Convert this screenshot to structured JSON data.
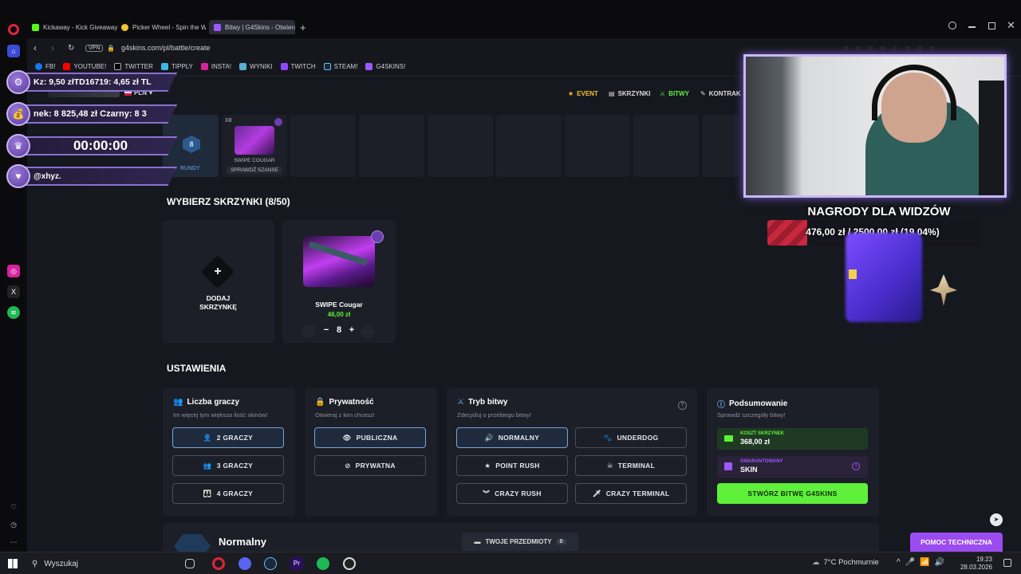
{
  "browser": {
    "tabs": [
      {
        "label": "Kickaway - Kick Giveaway",
        "color": "#53fc18"
      },
      {
        "label": "Picker Wheel - Spin the W",
        "color": "#f2c230"
      },
      {
        "label": "Bitwy | G4Skins - Otwieraj",
        "color": "#9b59ff",
        "active": true
      }
    ],
    "vpn": "VPN",
    "url": "g4skins.com/pl/battle/create",
    "bookmarks": [
      "FB!",
      "YOUTUBE!",
      "TWITTER",
      "TIPPLY",
      "INSTA!",
      "WYNIKI",
      "TWITCH",
      "STEAM!",
      "G4SKINS!"
    ]
  },
  "site": {
    "currency": "PLN",
    "nav": [
      "EVENT",
      "SKRZYNKI",
      "BITWY",
      "KONTRAK"
    ],
    "rounds": {
      "count": "8",
      "label": "RUNDY"
    },
    "top_case": {
      "multiplier": "X8",
      "name": "SWIPE COUGAR",
      "check_odds": "SPRAWDŹ SZANSE"
    },
    "select_title": "WYBIERZ SKRZYNKI (8/50)",
    "add_case": {
      "line1": "DODAJ",
      "line2": "SKRZYNKĘ"
    },
    "case_card": {
      "name": "SWIPE Cougar",
      "price": "46,00 zł",
      "qty": "8",
      "minus": "−",
      "plus": "+"
    },
    "settings_title": "USTAWIENIA",
    "players": {
      "title": "Liczba graczy",
      "subtitle": "Im więcej tym większa ilość skinów!",
      "options": [
        "2 GRACZY",
        "3 GRACZY",
        "4 GRACZY"
      ]
    },
    "privacy": {
      "title": "Prywatność",
      "subtitle": "Otwieraj z kim chcesz!",
      "options": [
        "PUBLICZNA",
        "PRYWATNA"
      ]
    },
    "mode": {
      "title": "Tryb bitwy",
      "subtitle": "Zdecyduj o przebiegu bitwy!",
      "options": [
        "NORMALNY",
        "UNDERDOG",
        "POINT RUSH",
        "TERMINAL",
        "CRAZY RUSH",
        "CRAZY TERMINAL"
      ]
    },
    "summary": {
      "title": "Podsumowanie",
      "subtitle": "Sprawdź szczegóły bitwy!",
      "cost_label": "KOSZT SKRZYNEK",
      "cost_value": "368,00 zł",
      "guaranteed_label": "GWARANTOWANY",
      "guaranteed_value": "SKIN",
      "create_button": "STWÓRZ BITWĘ G4SKINS"
    },
    "mode_heading": "Normalny",
    "my_items": {
      "label": "TWOJE PRZEDMIOTY",
      "count": "0"
    },
    "support_button": "POMOC TECHNICZNA"
  },
  "overlay": {
    "rows": [
      "Kz: 9,50 złTD16719: 4,65 zł TL",
      "nek: 8 825,48 zł Czarny: 8 3",
      "00:00:00",
      "@xhyz."
    ],
    "rewards_title": "NAGRODY DLA WIDZÓW",
    "rewards_progress": "476,00 zł / 2500,00 zł (19.04%)",
    "progress_fraction": 0.1904
  },
  "taskbar": {
    "search": "Wyszukaj",
    "weather": "7°C  Pochmurnie",
    "time": "19:23",
    "date": "28.03.2026"
  },
  "colors": {
    "accent_green": "#5ef03a",
    "accent_purple": "#9b59ff",
    "gold": "#f2c230",
    "blue_select": "#7aa3d6"
  }
}
